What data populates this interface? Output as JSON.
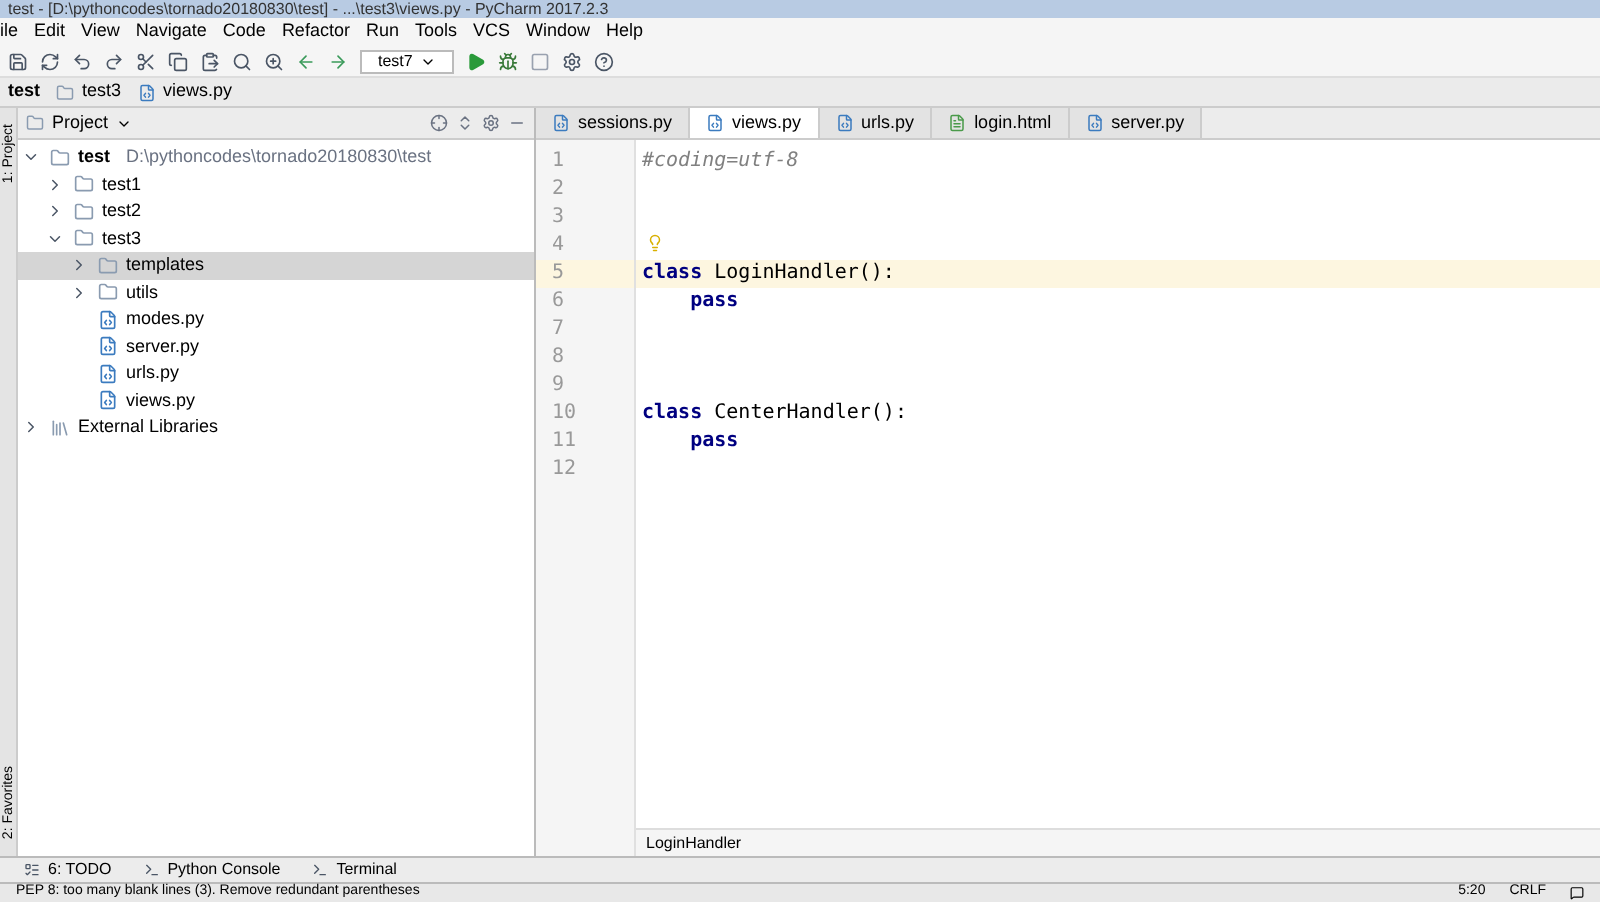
{
  "window": {
    "title": "test - [D:\\pythoncodes\\tornado20180830\\test] - ...\\test3\\views.py - PyCharm 2017.2.3"
  },
  "menu": [
    "ile",
    "Edit",
    "View",
    "Navigate",
    "Code",
    "Refactor",
    "Run",
    "Tools",
    "VCS",
    "Window",
    "Help"
  ],
  "toolbar": {
    "run_config": "test7"
  },
  "breadcrumbs": [
    "test",
    "test3",
    "views.py"
  ],
  "project_panel": {
    "title": "Project",
    "tree": [
      {
        "label": "test",
        "path": "D:\\pythoncodes\\tornado20180830\\test",
        "kind": "folder",
        "expanded": true,
        "selected": false,
        "children": [
          {
            "label": "test1",
            "kind": "folder",
            "expanded": false,
            "selected": false
          },
          {
            "label": "test2",
            "kind": "folder",
            "expanded": false,
            "selected": false
          },
          {
            "label": "test3",
            "kind": "folder",
            "expanded": true,
            "selected": false,
            "children": [
              {
                "label": "templates",
                "kind": "folder",
                "expanded": false,
                "selected": true
              },
              {
                "label": "utils",
                "kind": "folder",
                "expanded": false,
                "selected": false
              },
              {
                "label": "modes.py",
                "kind": "file",
                "selected": false
              },
              {
                "label": "server.py",
                "kind": "file",
                "selected": false
              },
              {
                "label": "urls.py",
                "kind": "file",
                "selected": false
              },
              {
                "label": "views.py",
                "kind": "file",
                "selected": false
              }
            ]
          }
        ]
      },
      {
        "label": "External Libraries",
        "kind": "library",
        "expanded": false,
        "selected": false
      }
    ]
  },
  "side_strip": [
    "1: Project",
    "2: Favorites"
  ],
  "editor_tabs": [
    {
      "label": "sessions.py",
      "kind": "py",
      "selected": false
    },
    {
      "label": "views.py",
      "kind": "py",
      "selected": true
    },
    {
      "label": "urls.py",
      "kind": "py",
      "selected": false
    },
    {
      "label": "login.html",
      "kind": "html",
      "selected": false
    },
    {
      "label": "server.py",
      "kind": "py",
      "selected": false
    }
  ],
  "code_lines": [
    {
      "number": "1",
      "current": false,
      "tokens": [
        {
          "kind": "comment",
          "text": "#coding=utf-8"
        }
      ]
    },
    {
      "number": "2",
      "current": false
    },
    {
      "number": "3",
      "current": false
    },
    {
      "number": "4",
      "current": false
    },
    {
      "number": "5",
      "current": true,
      "tokens": [
        {
          "kind": "keyword",
          "text": "class"
        },
        {
          "kind": "plain",
          "text": " LoginHandler():"
        }
      ]
    },
    {
      "number": "6",
      "current": false,
      "tokens": [
        {
          "kind": "keyword",
          "text": "    pass"
        }
      ]
    },
    {
      "number": "7",
      "current": false
    },
    {
      "number": "8",
      "current": false
    },
    {
      "number": "9",
      "current": false
    },
    {
      "number": "10",
      "current": false,
      "tokens": [
        {
          "kind": "keyword",
          "text": "class"
        },
        {
          "kind": "plain",
          "text": " CenterHandler():"
        }
      ]
    },
    {
      "number": "11",
      "current": false,
      "tokens": [
        {
          "kind": "keyword",
          "text": "    pass"
        }
      ]
    },
    {
      "number": "12",
      "current": false
    }
  ],
  "editor_breadcrumb": "LoginHandler",
  "tool_tabs": [
    "6: TODO",
    "Python Console",
    "Terminal"
  ],
  "status_bar": {
    "message": "PEP 8: too many blank lines (3). Remove redundant parentheses",
    "position": "5:20",
    "line_separator": "CRLF"
  }
}
